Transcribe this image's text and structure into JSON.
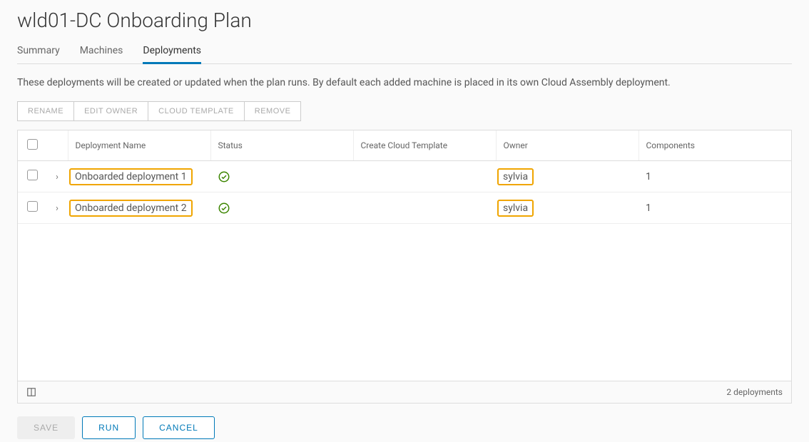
{
  "page": {
    "title": "wld01-DC Onboarding Plan"
  },
  "tabs": [
    {
      "label": "Summary",
      "active": false
    },
    {
      "label": "Machines",
      "active": false
    },
    {
      "label": "Deployments",
      "active": true
    }
  ],
  "description": "These deployments will be created or updated when the plan runs. By default each added machine is placed in its own Cloud Assembly deployment.",
  "actions": {
    "rename": "RENAME",
    "edit_owner": "EDIT OWNER",
    "cloud_template": "CLOUD TEMPLATE",
    "remove": "REMOVE"
  },
  "table": {
    "headers": {
      "name": "Deployment Name",
      "status": "Status",
      "template": "Create Cloud Template",
      "owner": "Owner",
      "components": "Components"
    },
    "rows": [
      {
        "name": "Onboarded deployment 1",
        "status": "success",
        "template": "",
        "owner": "sylvia",
        "components": "1"
      },
      {
        "name": "Onboarded deployment 2",
        "status": "success",
        "template": "",
        "owner": "sylvia",
        "components": "1"
      }
    ]
  },
  "footer": {
    "count_text": "2 deployments"
  },
  "buttons": {
    "save": "SAVE",
    "run": "RUN",
    "cancel": "CANCEL"
  }
}
